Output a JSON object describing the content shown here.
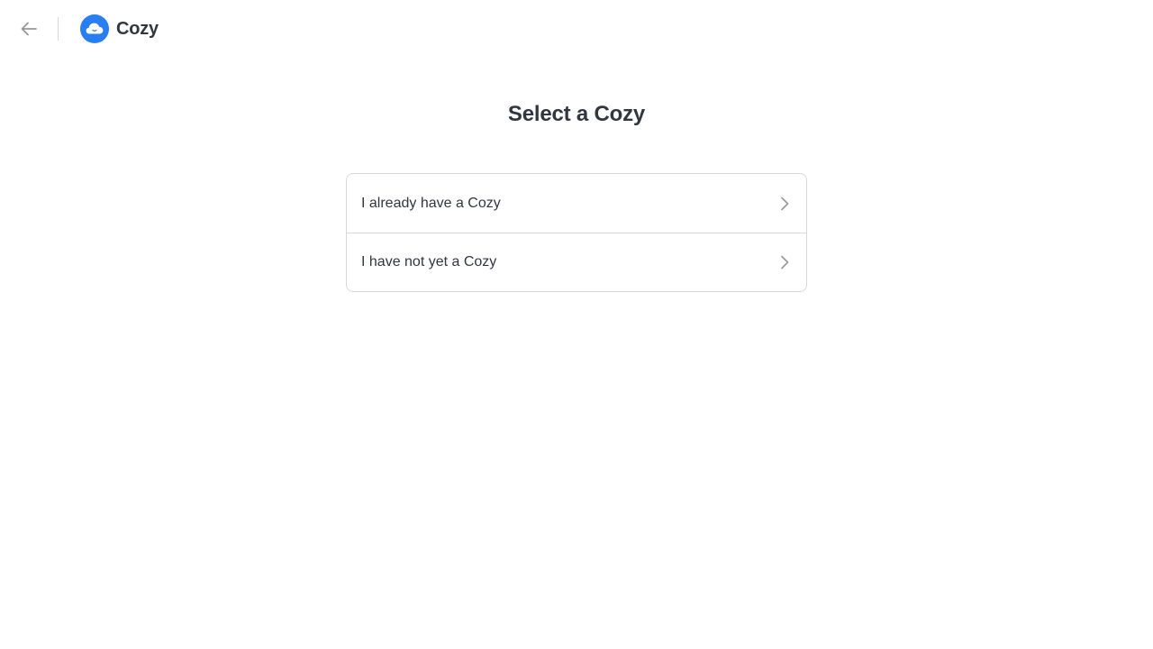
{
  "header": {
    "back_icon": "arrow-left-icon",
    "logo_icon": "cozy-cloud-logo-icon",
    "brand_name": "Cozy"
  },
  "main": {
    "title": "Select a Cozy",
    "options": [
      {
        "label": "I already have a Cozy",
        "icon": "chevron-right-icon"
      },
      {
        "label": "I have not yet a Cozy",
        "icon": "chevron-right-icon"
      }
    ]
  },
  "colors": {
    "brand_blue": "#297ef2",
    "text": "#32363f",
    "icon_grey": "#95999d",
    "border": "#d6d8da"
  }
}
